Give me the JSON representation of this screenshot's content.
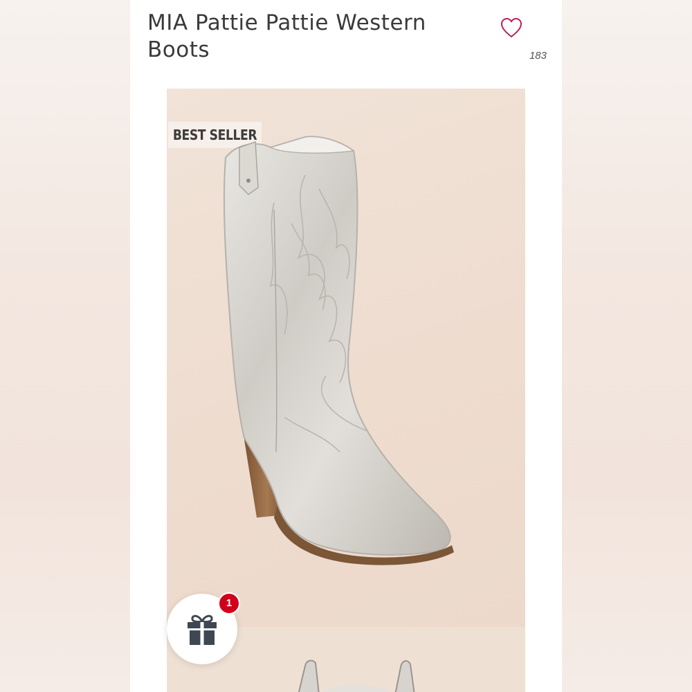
{
  "product": {
    "title": "MIA Pattie Pattie Western Boots",
    "like_count": "183",
    "badge": "BEST SELLER"
  },
  "gift": {
    "count": "1"
  },
  "icons": {
    "like": "heart-outline-icon",
    "gift": "gift-icon"
  },
  "colors": {
    "heart": "#c2185b",
    "badge_red": "#d0021b",
    "gift_icon": "#3f4753"
  }
}
